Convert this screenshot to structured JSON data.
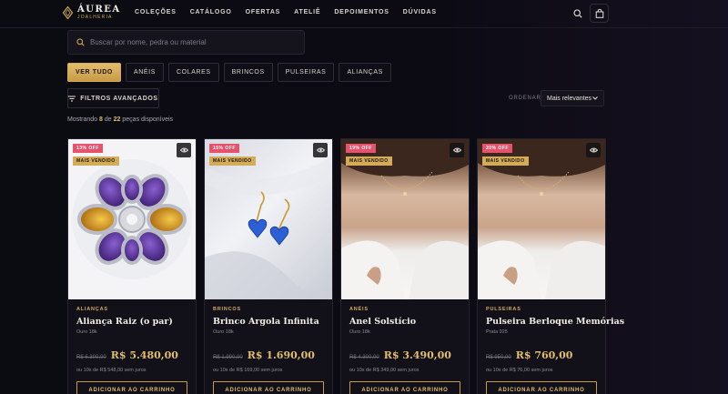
{
  "brand": {
    "name": "ÁUREA",
    "tagline": "JOALHERIA"
  },
  "nav": [
    "COLEÇÕES",
    "CATÁLOGO",
    "OFERTAS",
    "ATELIÊ",
    "DEPOIMENTOS",
    "DÚVIDAS"
  ],
  "search": {
    "placeholder": "Buscar por nome, pedra ou material",
    "value": ""
  },
  "filters": [
    "VER TUDO",
    "ANÉIS",
    "COLARES",
    "BRINCOS",
    "PULSEIRAS",
    "ALIANÇAS"
  ],
  "active_filter": "VER TUDO",
  "advanced_filters_label": "FILTROS AVANÇADOS",
  "sort": {
    "label": "ORDENAR",
    "value": "Mais relevantes"
  },
  "results": {
    "prefix": "Mostrando",
    "shown": "8",
    "of": "de",
    "total": "22",
    "suffix": "peças disponíveis"
  },
  "products": [
    {
      "discount": "13% OFF",
      "best_seller": "MAIS VENDIDO",
      "category": "ALIANÇAS",
      "name": "Aliança Raiz (o par)",
      "material": "Ouro 18k",
      "old_price": "R$ 6.300,00",
      "price": "R$ 5.480,00",
      "installments": "ou 10x de R$ 548,00 sem juros",
      "cta": "ADICIONAR AO CARRINHO",
      "image": "gemstone-flower-ring"
    },
    {
      "discount": "15% OFF",
      "best_seller": "MAIS VENDIDO",
      "category": "BRINCOS",
      "name": "Brinco Argola Infinita",
      "material": "Ouro 18k",
      "old_price": "R$ 1.990,00",
      "price": "R$ 1.690,00",
      "installments": "ou 10x de R$ 169,00 sem juros",
      "cta": "ADICIONAR AO CARRINHO",
      "image": "blue-heart-earrings"
    },
    {
      "discount": "19% OFF",
      "best_seller": "MAIS VENDIDO",
      "category": "ANÉIS",
      "name": "Anel Solstício",
      "material": "Ouro 18k",
      "old_price": "R$ 4.300,00",
      "price": "R$ 3.490,00",
      "installments": "ou 10x de R$ 349,00 sem juros",
      "cta": "ADICIONAR AO CARRINHO",
      "image": "model-necklace"
    },
    {
      "discount": "20% OFF",
      "best_seller": "MAIS VENDIDO",
      "category": "PULSEIRAS",
      "name": "Pulseira Berloque Memórias",
      "material": "Prata 925",
      "old_price": "R$ 950,00",
      "price": "R$ 760,00",
      "installments": "ou 10x de R$ 76,00 sem juros",
      "cta": "ADICIONAR AO CARRINHO",
      "image": "model-necklace"
    }
  ],
  "colors": {
    "gold": "#e2bd6d",
    "discount": "#e4526b",
    "background": "#0b0b12"
  }
}
